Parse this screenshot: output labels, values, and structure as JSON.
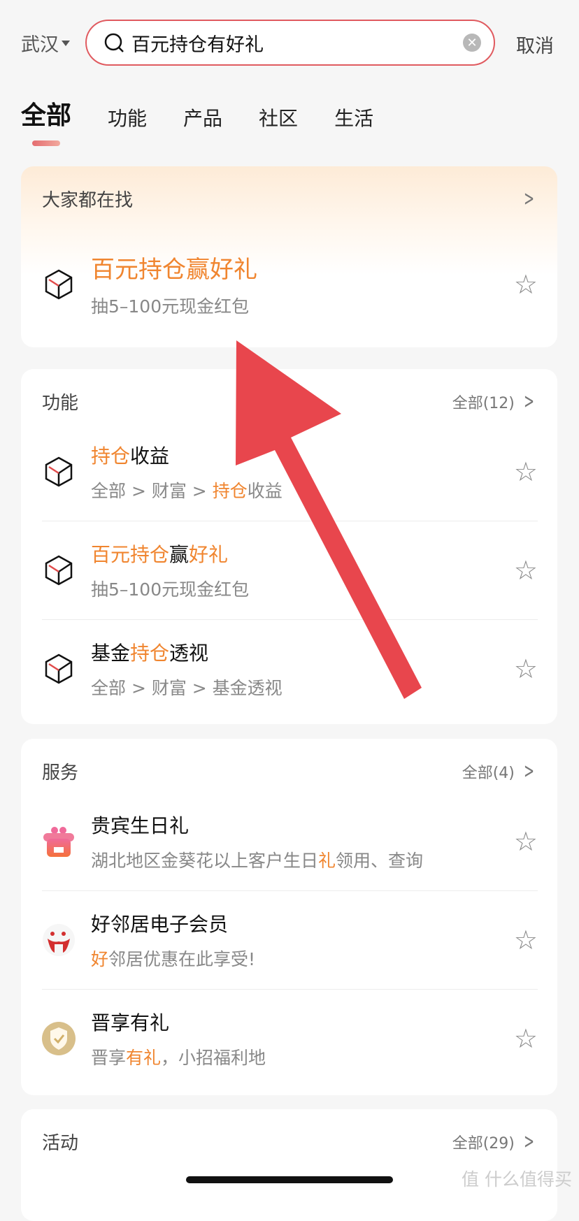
{
  "header": {
    "city": "武汉",
    "search_value": "百元持仓有好礼",
    "cancel": "取消"
  },
  "tabs": [
    "全部",
    "功能",
    "产品",
    "社区",
    "生活"
  ],
  "popular": {
    "title": "大家都在找",
    "item": {
      "title": "百元持仓赢好礼",
      "subtitle": "抽5–100元现金红包"
    }
  },
  "features": {
    "title": "功能",
    "more": "全部(12)",
    "items": [
      {
        "title": [
          [
            "持仓",
            true
          ],
          [
            "收益",
            false
          ]
        ],
        "subtitle": [
          [
            "全部 > 财富 > ",
            false
          ],
          [
            "持仓",
            true
          ],
          [
            "收益",
            false
          ]
        ]
      },
      {
        "title": [
          [
            "百元持仓",
            true
          ],
          [
            "赢",
            false
          ],
          [
            "好礼",
            true
          ]
        ],
        "subtitle": [
          [
            "抽5–100元现金红包",
            false
          ]
        ]
      },
      {
        "title": [
          [
            "基金",
            false
          ],
          [
            "持仓",
            true
          ],
          [
            "透视",
            false
          ]
        ],
        "subtitle": [
          [
            "全部 > 财富 > 基金透视",
            false
          ]
        ]
      }
    ]
  },
  "services": {
    "title": "服务",
    "more": "全部(4)",
    "items": [
      {
        "icon": "birthday-gift-icon",
        "title": [
          [
            "贵宾生日礼",
            false
          ]
        ],
        "subtitle": [
          [
            "湖北地区金葵花以上客户生日",
            false
          ],
          [
            "礼",
            true
          ],
          [
            "领用、查询",
            false
          ]
        ]
      },
      {
        "icon": "neighbor-logo-icon",
        "title": [
          [
            "好邻居电子会员",
            false
          ]
        ],
        "subtitle": [
          [
            "好",
            true
          ],
          [
            "邻居优惠在此享受!",
            false
          ]
        ]
      },
      {
        "icon": "shield-check-icon",
        "title": [
          [
            "晋享有礼",
            false
          ]
        ],
        "subtitle": [
          [
            "晋享",
            false
          ],
          [
            "有礼",
            true
          ],
          [
            "，小招福利地",
            false
          ]
        ]
      }
    ]
  },
  "activities": {
    "title": "活动",
    "more": "全部(29)"
  },
  "watermark": "值 什么值得买",
  "colors": {
    "accent": "#f0852f",
    "search_border": "#e05a5f",
    "arrow": "#e8464d"
  }
}
